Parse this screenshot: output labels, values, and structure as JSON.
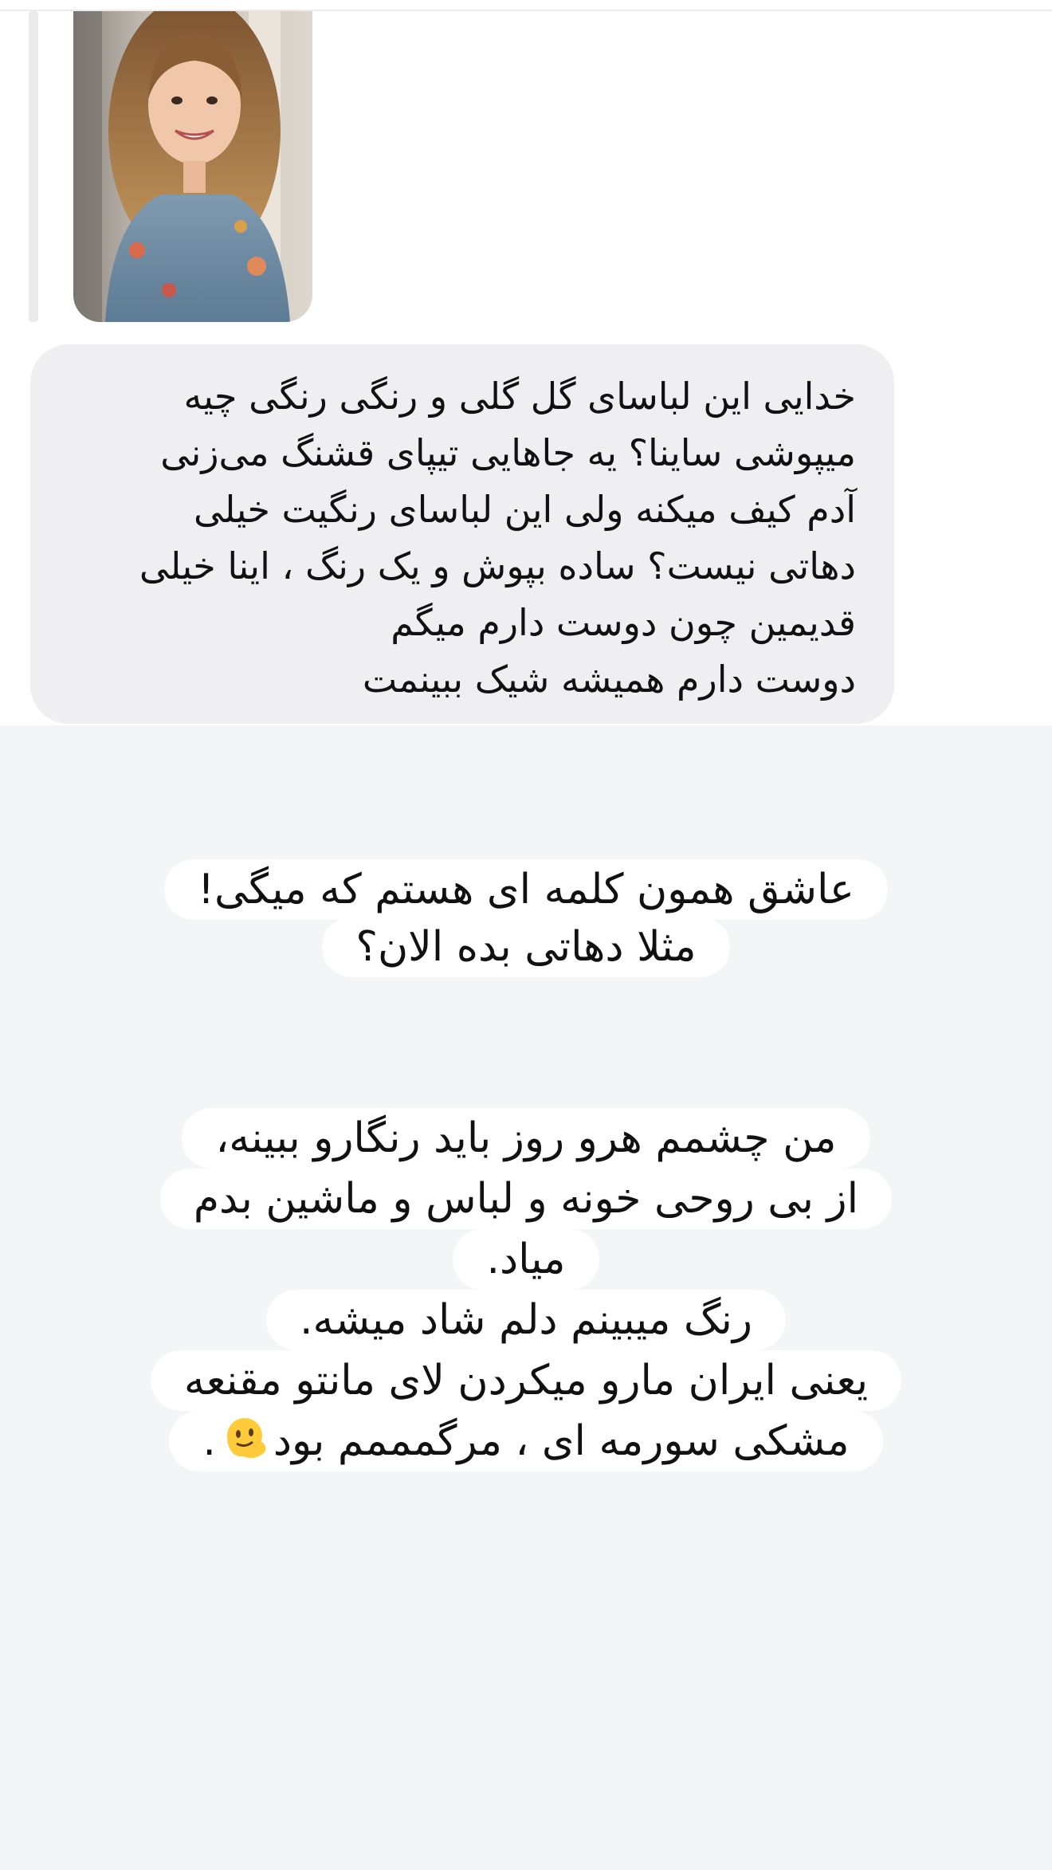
{
  "reply": {
    "lines": [
      "خدایی این لباسای گل گلی و رنگی رنگی چیه",
      "میپوشی ساینا؟ یه جاهایی تیپای قشنگ می‌زنی",
      "آدم کیف میکنه ولی این لباسای رنگیت خیلی",
      "دهاتی نیست؟ ساده بپوش و یک رنگ ، اینا خیلی",
      "قدیمین چون دوست دارم میگم",
      "دوست دارم همیشه شیک ببینمت"
    ]
  },
  "story": {
    "caption_one": [
      "عاشق همون کلمه ای هستم که میگی!",
      "مثلا دهاتی بده الان؟"
    ],
    "caption_two": [
      "من چشمم هرو روز باید رنگارو ببینه،",
      "از بی روحی خونه و لباس و ماشین بدم",
      "میاد.",
      "رنگ میبینم دلم شاد میشه.",
      "یعنی ایران مارو میکردن لای مانتو مقنعه",
      "مشکی سورمه ای ، مرگمممم بود",
      "."
    ],
    "emoji": "melting-face-icon"
  },
  "colors": {
    "reply_bubble": "#efeff1",
    "story_background": "#f4f5f7",
    "caption_background": "#ffffff",
    "text": "#111111"
  }
}
